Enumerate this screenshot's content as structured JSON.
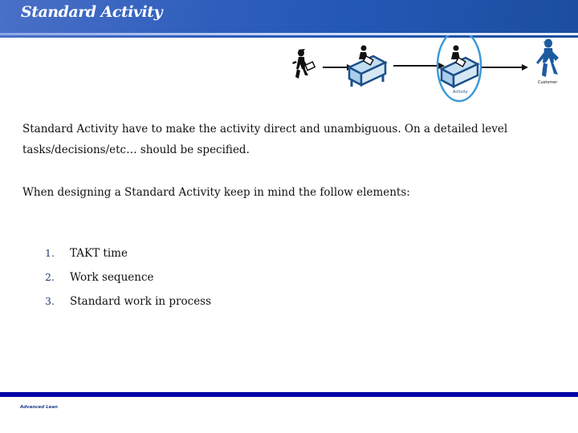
{
  "header": {
    "title": "Standard Activity"
  },
  "diagram": {
    "nodes": [
      {
        "name": "supplier",
        "icon": "walking-person-with-document-icon",
        "label": ""
      },
      {
        "name": "process-desk",
        "icon": "person-at-desk-icon",
        "label": ""
      },
      {
        "name": "activity",
        "icon": "person-at-desk-highlighted-icon",
        "label": "Activity"
      },
      {
        "name": "customer",
        "icon": "customer-person-icon",
        "label": "Customer"
      }
    ],
    "colors": {
      "desk_fill": "#c3ddf2",
      "desk_stroke": "#1b4f8a",
      "highlight_ring": "#3c9ad6",
      "customer": "#1d5aa0"
    }
  },
  "content": {
    "paragraph1": "Standard Activity have to make the activity direct and unambiguous. On a detailed level tasks/decisions/etc… should be specified.",
    "paragraph2": "When designing a Standard Activity keep in mind the follow elements:",
    "list": [
      {
        "num": "1.",
        "text": "TAKT time"
      },
      {
        "num": "2.",
        "text": "Work sequence"
      },
      {
        "num": "3.",
        "text": "Standard work in process"
      }
    ]
  },
  "footer": {
    "text": "Advanced Lean",
    "bar_color": "#0000a8"
  }
}
